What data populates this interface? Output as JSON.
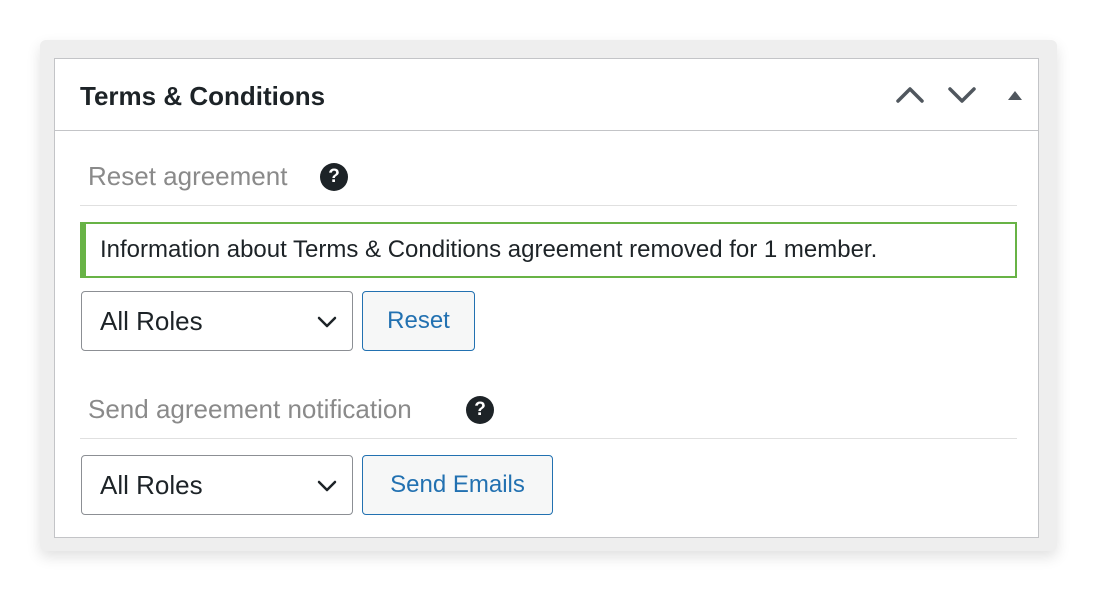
{
  "panel": {
    "title": "Terms & Conditions",
    "controls": {
      "move_up_icon": "chevron-up-icon",
      "move_down_icon": "chevron-down-icon",
      "toggle_icon": "triangle-up-icon"
    }
  },
  "reset_section": {
    "title": "Reset agreement",
    "help": "?",
    "notice": "Information about Terms & Conditions agreement removed for 1 member.",
    "role_select": {
      "value": "All Roles"
    },
    "button_label": "Reset"
  },
  "notify_section": {
    "title": "Send agreement notification",
    "help": "?",
    "role_select": {
      "value": "All Roles"
    },
    "button_label": "Send Emails"
  },
  "colors": {
    "notice_border": "#68b346",
    "button_accent": "#2271b1",
    "title_text": "#1d2327",
    "section_text": "#8a8a8a"
  }
}
